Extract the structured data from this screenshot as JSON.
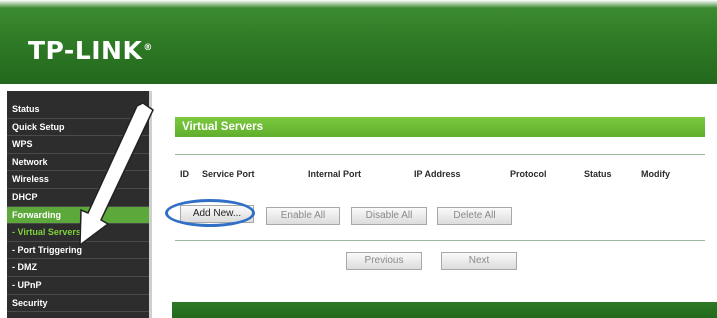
{
  "header": {
    "logo_text": "TP-LINK",
    "logo_mark": "®",
    "bg_color": "#2e7a25"
  },
  "sidebar": {
    "items": [
      {
        "label": "Status",
        "active": false
      },
      {
        "label": "Quick Setup",
        "active": false
      },
      {
        "label": "WPS",
        "active": false
      },
      {
        "label": "Network",
        "active": false
      },
      {
        "label": "Wireless",
        "active": false
      },
      {
        "label": "DHCP",
        "active": false
      },
      {
        "label": "Forwarding",
        "active": true
      },
      {
        "label": "- Virtual Servers",
        "active": false,
        "selected_sub": true
      },
      {
        "label": "- Port Triggering",
        "active": false
      },
      {
        "label": "- DMZ",
        "active": false
      },
      {
        "label": "- UPnP",
        "active": false
      },
      {
        "label": "Security",
        "active": false
      }
    ],
    "active_color": "#5ca83b"
  },
  "main": {
    "title": "Virtual Servers",
    "table": {
      "columns": [
        "ID",
        "Service Port",
        "Internal Port",
        "IP Address",
        "Protocol",
        "Status",
        "Modify"
      ]
    },
    "buttons": {
      "add_new": "Add New...",
      "enable_all": "Enable All",
      "disable_all": "Disable All",
      "delete_all": "Delete All",
      "previous": "Previous",
      "next": "Next"
    },
    "highlight_color": "#2f6fc5"
  },
  "annotation": {
    "arrow_icon": "white-arrow-pointer-icon"
  }
}
